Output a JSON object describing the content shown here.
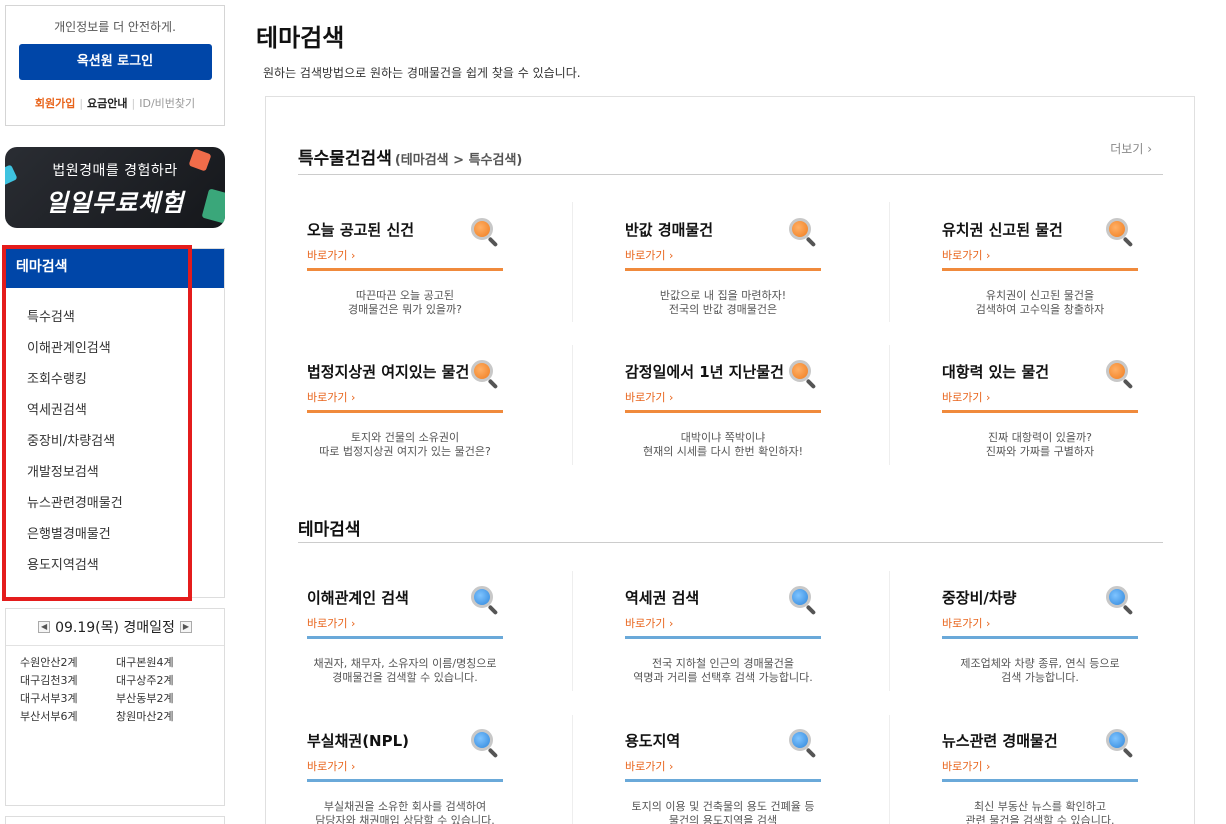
{
  "login": {
    "message": "개인정보를 더 안전하게.",
    "button": "옥션원 로그인",
    "join": "회원가입",
    "price": "요금안내",
    "find": "ID/비번찾기"
  },
  "promo": {
    "line1": "법원경매를 경험하라",
    "line2": "일일무료체험"
  },
  "theme_menu": {
    "title": "테마검색",
    "items": [
      "특수검색",
      "이해관계인검색",
      "조회수랭킹",
      "역세권검색",
      "중장비/차량검색",
      "개발정보검색",
      "뉴스관련경매물건",
      "은행별경매물건",
      "용도지역검색"
    ]
  },
  "schedule": {
    "title": "09.19(목) 경매일정",
    "courts": [
      "수원안산2계",
      "대구본원4계",
      "대구김천3계",
      "대구상주2계",
      "대구서부3계",
      "부산동부2계",
      "부산서부6계",
      "창원마산2계"
    ]
  },
  "main": {
    "title": "테마검색",
    "desc": "원하는 검색방법으로 원하는 경매물건을 쉽게 찾을 수 있습니다.",
    "special": {
      "title": "특수물건검색",
      "path": "(테마검색 > 특수검색)",
      "more": "더보기 ›",
      "cards": [
        {
          "title": "오늘 공고된 신건",
          "go": "바로가기 ›",
          "desc1": "따끈따끈 오늘 공고된",
          "desc2": "경매물건은 뭐가 있을까?"
        },
        {
          "title": "반값 경매물건",
          "go": "바로가기 ›",
          "desc1": "반값으로 내 집을 마련하자!",
          "desc2": "전국의 반값 경매물건은"
        },
        {
          "title": "유치권 신고된 물건",
          "go": "바로가기 ›",
          "desc1": "유치권이 신고된 물건을",
          "desc2": "검색하여 고수익을 창출하자"
        },
        {
          "title": "법정지상권 여지있는 물건",
          "go": "바로가기 ›",
          "desc1": "토지와 건물의 소유권이",
          "desc2": "따로 법정지상권 여지가 있는 물건은?"
        },
        {
          "title": "감정일에서 1년 지난물건",
          "go": "바로가기 ›",
          "desc1": "대박이냐 쪽박이냐",
          "desc2": "현재의 시세를 다시 한번 확인하자!"
        },
        {
          "title": "대항력 있는 물건",
          "go": "바로가기 ›",
          "desc1": "진짜 대항력이 있을까?",
          "desc2": "진짜와 가짜를 구별하자"
        }
      ]
    },
    "theme": {
      "title": "테마검색",
      "cards": [
        {
          "title": "이해관계인 검색",
          "go": "바로가기 ›",
          "desc1": "채권자, 채무자, 소유자의 이름/명칭으로",
          "desc2": "경매물건을 검색할 수 있습니다."
        },
        {
          "title": "역세권 검색",
          "go": "바로가기 ›",
          "desc1": "전국 지하철 인근의 경매물건을",
          "desc2": "역명과 거리를 선택후 검색 가능합니다."
        },
        {
          "title": "중장비/차량",
          "go": "바로가기 ›",
          "desc1": "제조업체와 차량 종류, 연식 등으로",
          "desc2": "검색 가능합니다."
        },
        {
          "title": "부실채권(NPL)",
          "go": "바로가기 ›",
          "desc1": "부실채권을 소유한 회사를 검색하여",
          "desc2": "담당자와 채권매입 상담할 수 있습니다."
        },
        {
          "title": "용도지역",
          "go": "바로가기 ›",
          "desc1": "토지의 이용 및 건축물의 용도 건폐율 등",
          "desc2": "물건의 용도지역을 검색"
        },
        {
          "title": "뉴스관련 경매물건",
          "go": "바로가기 ›",
          "desc1": "최신 부동산 뉴스를 확인하고",
          "desc2": "관련 물건을 검색할 수 있습니다."
        }
      ]
    }
  },
  "colors": {
    "brand_blue": "#0046a8",
    "highlight_red": "#e41c1c",
    "accent_orange": "#e8641b",
    "bar_orange": "#f08a3c",
    "bar_blue": "#6aa9d9"
  }
}
